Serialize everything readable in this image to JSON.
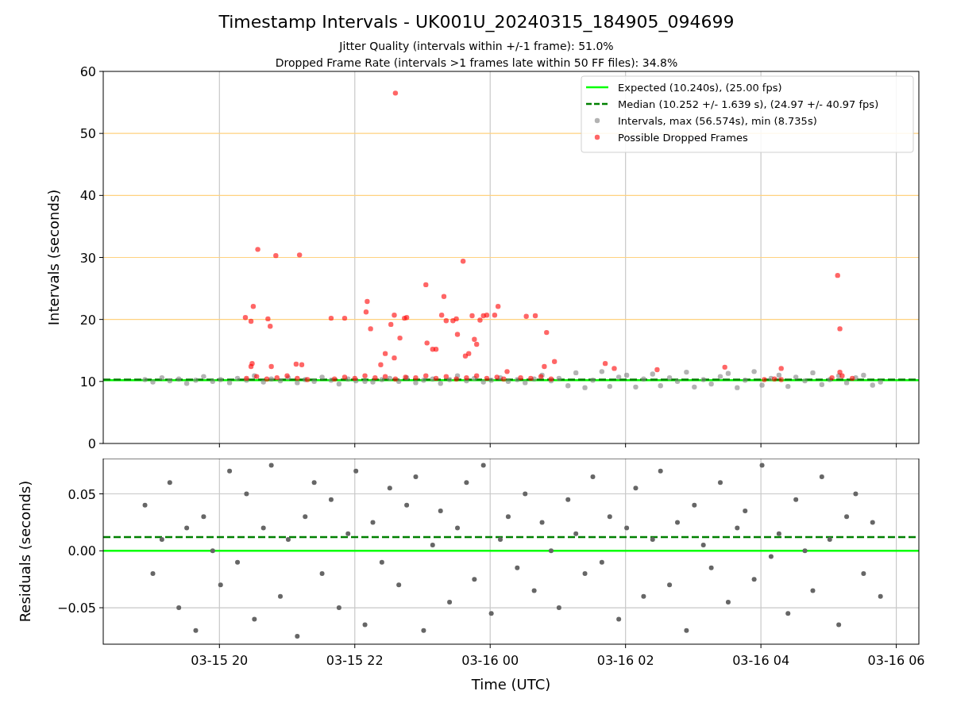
{
  "title": "Timestamp Intervals - UK001U_20240315_184905_094699",
  "subtitles": [
    "Jitter Quality (intervals within +/-1 frame): 51.0%",
    "Dropped Frame Rate (intervals >1 frames late within 50 FF files): 34.8%"
  ],
  "charts": [
    {
      "chart_data": {
        "type": "scatter",
        "grid": true,
        "legend": "upper right",
        "ylabel": "Intervals (seconds)",
        "xlim": [
          "2024-03-15 18:17",
          "2024-03-16 06:20"
        ],
        "ylim": [
          0,
          60
        ],
        "yticks": [
          {
            "value": 0,
            "label": "0"
          },
          {
            "value": 10,
            "label": "10"
          },
          {
            "value": 20,
            "label": "20"
          },
          {
            "value": 30,
            "label": "30"
          },
          {
            "value": 40,
            "label": "40"
          },
          {
            "value": 50,
            "label": "50"
          },
          {
            "value": 60,
            "label": "60"
          }
        ],
        "series": [
          {
            "name": "Expected (10.240s), (25.00 fps)",
            "type": "line",
            "line_style": "solid",
            "color": "#00ff00",
            "x": [
              "2024-03-15 18:17",
              "2024-03-16 06:20"
            ],
            "values": [
              10.2,
              10.2
            ]
          },
          {
            "name": "Median (10.252 +/- 1.639 s), (24.97 +/- 40.97 fps)",
            "type": "line",
            "line_style": "dashed",
            "color": "#008000",
            "x": [
              "2024-03-15 18:17",
              "2024-03-16 06:20"
            ],
            "values": [
              10.3,
              10.3
            ]
          },
          {
            "name": "Intervals, max (56.574s), min (8.735s)",
            "color": "#808080",
            "x": [
              "2024-03-15 18:54",
              "2024-03-15 19:01",
              "2024-03-15 19:09",
              "2024-03-15 19:16",
              "2024-03-15 19:24",
              "2024-03-15 19:31",
              "2024-03-15 19:39",
              "2024-03-15 19:46",
              "2024-03-15 19:54",
              "2024-03-15 20:01",
              "2024-03-15 20:09",
              "2024-03-15 20:16",
              "2024-03-15 20:24",
              "2024-03-15 20:31",
              "2024-03-15 20:39",
              "2024-03-15 20:46",
              "2024-03-15 20:54",
              "2024-03-15 21:01",
              "2024-03-15 21:09",
              "2024-03-15 21:16",
              "2024-03-15 21:24",
              "2024-03-15 21:31",
              "2024-03-15 21:39",
              "2024-03-15 21:46",
              "2024-03-15 21:54",
              "2024-03-15 22:01",
              "2024-03-15 22:09",
              "2024-03-15 22:16",
              "2024-03-15 22:24",
              "2024-03-15 22:31",
              "2024-03-15 22:39",
              "2024-03-15 22:46",
              "2024-03-15 22:54",
              "2024-03-15 23:01",
              "2024-03-15 23:09",
              "2024-03-15 23:16",
              "2024-03-15 23:24",
              "2024-03-15 23:31",
              "2024-03-15 23:39",
              "2024-03-15 23:46",
              "2024-03-15 23:54",
              "2024-03-16 00:01",
              "2024-03-16 00:09",
              "2024-03-16 00:16",
              "2024-03-16 00:24",
              "2024-03-16 00:31",
              "2024-03-16 00:39",
              "2024-03-16 00:46",
              "2024-03-16 00:54",
              "2024-03-16 01:01",
              "2024-03-16 01:09",
              "2024-03-16 01:16",
              "2024-03-16 01:24",
              "2024-03-16 01:31",
              "2024-03-16 01:39",
              "2024-03-16 01:46",
              "2024-03-16 01:54",
              "2024-03-16 02:01",
              "2024-03-16 02:09",
              "2024-03-16 02:16",
              "2024-03-16 02:24",
              "2024-03-16 02:31",
              "2024-03-16 02:39",
              "2024-03-16 02:46",
              "2024-03-16 02:54",
              "2024-03-16 03:01",
              "2024-03-16 03:09",
              "2024-03-16 03:16",
              "2024-03-16 03:24",
              "2024-03-16 03:31",
              "2024-03-16 03:39",
              "2024-03-16 03:46",
              "2024-03-16 03:54",
              "2024-03-16 04:01",
              "2024-03-16 04:09",
              "2024-03-16 04:16",
              "2024-03-16 04:24",
              "2024-03-16 04:31",
              "2024-03-16 04:39",
              "2024-03-16 04:46",
              "2024-03-16 04:54",
              "2024-03-16 05:01",
              "2024-03-16 05:09",
              "2024-03-16 05:16",
              "2024-03-16 05:24",
              "2024-03-16 05:31",
              "2024-03-16 05:39",
              "2024-03-16 05:46"
            ],
            "values": [
              10.3,
              9.9,
              10.6,
              10.1,
              10.4,
              9.7,
              10.2,
              10.8,
              10.0,
              10.3,
              9.8,
              10.5,
              10.2,
              10.9,
              9.9,
              10.4,
              10.1,
              10.6,
              9.8,
              10.3,
              10.0,
              10.7,
              10.2,
              9.6,
              10.4,
              10.1,
              10.0,
              9.9,
              10.3,
              10.5,
              10.0,
              10.6,
              9.8,
              10.2,
              10.4,
              9.7,
              10.3,
              10.9,
              10.1,
              10.5,
              9.9,
              10.2,
              10.6,
              10.0,
              10.3,
              9.8,
              10.4,
              11.0,
              10.1,
              10.5,
              9.3,
              11.4,
              9.0,
              10.2,
              11.6,
              9.2,
              10.7,
              11.0,
              9.1,
              10.4,
              11.2,
              9.3,
              10.6,
              10.0,
              11.5,
              9.1,
              10.3,
              9.6,
              10.8,
              11.3,
              9.0,
              10.2,
              11.6,
              9.4,
              10.5,
              11.0,
              9.2,
              10.7,
              10.1,
              11.4,
              9.5,
              10.3,
              10.9,
              9.8,
              10.6,
              11.0,
              9.4,
              9.9
            ]
          },
          {
            "name": "Possible Dropped Frames",
            "color": "#ff0000",
            "x": [
              "2024-03-15 20:23",
              "2024-03-15 20:28",
              "2024-03-15 20:30",
              "2024-03-15 20:34",
              "2024-03-15 20:28",
              "2024-03-15 20:29",
              "2024-03-15 20:43",
              "2024-03-15 20:45",
              "2024-03-15 20:50",
              "2024-03-15 20:46",
              "2024-03-15 21:08",
              "2024-03-15 21:11",
              "2024-03-15 21:13",
              "2024-03-15 21:39",
              "2024-03-15 21:51",
              "2024-03-15 22:11",
              "2024-03-15 22:10",
              "2024-03-15 22:14",
              "2024-03-15 22:32",
              "2024-03-15 22:36",
              "2024-03-15 22:35",
              "2024-03-15 22:40",
              "2024-03-15 22:44",
              "2024-03-15 22:46",
              "2024-03-15 22:27",
              "2024-03-15 22:23",
              "2024-03-15 22:35",
              "2024-03-15 23:03",
              "2024-03-15 23:04",
              "2024-03-15 23:09",
              "2024-03-15 23:12",
              "2024-03-15 23:17",
              "2024-03-15 23:19",
              "2024-03-15 23:21",
              "2024-03-15 23:27",
              "2024-03-15 23:30",
              "2024-03-15 23:31",
              "2024-03-15 23:36",
              "2024-03-15 23:38",
              "2024-03-15 23:41",
              "2024-03-15 23:44",
              "2024-03-15 23:46",
              "2024-03-15 23:48",
              "2024-03-15 23:51",
              "2024-03-15 23:54",
              "2024-03-15 23:57",
              "2024-03-16 00:04",
              "2024-03-16 00:07",
              "2024-03-16 00:15",
              "2024-03-16 00:32",
              "2024-03-16 00:40",
              "2024-03-16 00:50",
              "2024-03-16 00:48",
              "2024-03-16 00:57",
              "2024-03-16 01:42",
              "2024-03-16 01:50",
              "2024-03-16 02:28",
              "2024-03-16 03:28",
              "2024-03-16 04:18",
              "2024-03-16 05:08",
              "2024-03-16 05:10",
              "2024-03-16 05:10",
              "2024-03-15 20:24",
              "2024-03-15 20:33",
              "2024-03-15 20:42",
              "2024-03-15 20:51",
              "2024-03-15 21:00",
              "2024-03-15 21:09",
              "2024-03-15 21:18",
              "2024-03-15 21:42",
              "2024-03-15 21:51",
              "2024-03-15 22:00",
              "2024-03-15 22:09",
              "2024-03-15 22:18",
              "2024-03-15 22:27",
              "2024-03-15 22:36",
              "2024-03-15 22:45",
              "2024-03-15 22:54",
              "2024-03-15 23:03",
              "2024-03-15 23:12",
              "2024-03-15 23:21",
              "2024-03-15 23:30",
              "2024-03-15 23:39",
              "2024-03-15 23:48",
              "2024-03-15 23:57",
              "2024-03-16 00:06",
              "2024-03-16 00:12",
              "2024-03-16 00:27",
              "2024-03-16 00:36",
              "2024-03-16 00:45",
              "2024-03-16 00:54",
              "2024-03-16 04:03",
              "2024-03-16 04:12",
              "2024-03-16 04:18",
              "2024-03-16 05:03",
              "2024-03-16 05:12",
              "2024-03-16 05:21"
            ],
            "values": [
              20.3,
              19.7,
              22.1,
              31.3,
              12.4,
              12.9,
              20.1,
              18.9,
              30.3,
              12.4,
              12.8,
              30.4,
              12.7,
              20.2,
              20.2,
              22.9,
              21.2,
              18.5,
              19.2,
              56.5,
              20.7,
              17.0,
              20.2,
              20.3,
              14.5,
              12.7,
              13.8,
              25.6,
              16.2,
              15.2,
              15.2,
              20.7,
              23.7,
              19.8,
              19.8,
              20.1,
              17.6,
              29.4,
              14.1,
              14.5,
              20.6,
              16.8,
              16.0,
              19.9,
              20.6,
              20.7,
              20.7,
              22.1,
              11.6,
              20.5,
              20.6,
              17.9,
              12.4,
              13.2,
              12.9,
              12.1,
              11.9,
              12.3,
              12.1,
              27.1,
              18.5,
              11.5,
              10.5,
              10.8,
              10.4,
              10.6,
              10.9,
              10.5,
              10.3,
              10.4,
              10.7,
              10.5,
              10.9,
              10.6,
              10.8,
              10.4,
              10.7,
              10.6,
              10.9,
              10.5,
              10.8,
              10.4,
              10.6,
              10.9,
              10.5,
              10.7,
              10.4,
              10.6,
              10.5,
              10.8,
              10.4,
              10.3,
              10.4,
              10.3,
              10.6,
              10.9,
              10.5
            ]
          }
        ]
      }
    },
    {
      "chart_data": {
        "type": "scatter",
        "grid": true,
        "xlabel": "Time (UTC)",
        "ylabel": "Residuals (seconds)",
        "xlim": [
          "2024-03-15 18:17",
          "2024-03-16 06:20"
        ],
        "ylim": [
          -0.082,
          0.081
        ],
        "xticks": [
          {
            "value": "2024-03-15 20:00",
            "label": "03-15 20"
          },
          {
            "value": "2024-03-15 22:00",
            "label": "03-15 22"
          },
          {
            "value": "2024-03-16 00:00",
            "label": "03-16 00"
          },
          {
            "value": "2024-03-16 02:00",
            "label": "03-16 02"
          },
          {
            "value": "2024-03-16 04:00",
            "label": "03-16 04"
          },
          {
            "value": "2024-03-16 06:00",
            "label": "03-16 06"
          }
        ],
        "yticks": [
          {
            "value": -0.05,
            "label": "−0.05"
          },
          {
            "value": 0,
            "label": "0.00"
          },
          {
            "value": 0.05,
            "label": "0.05"
          }
        ],
        "series": [
          {
            "type": "line",
            "line_style": "solid",
            "color": "#00ff00",
            "x": [
              "2024-03-15 18:17",
              "2024-03-16 06:20"
            ],
            "values": [
              0,
              0
            ]
          },
          {
            "type": "line",
            "line_style": "dashed",
            "color": "#008000",
            "x": [
              "2024-03-15 18:17",
              "2024-03-16 06:20"
            ],
            "values": [
              0.012,
              0.012
            ]
          },
          {
            "color": "#666666",
            "x": [
              "2024-03-15 18:54",
              "2024-03-15 19:01",
              "2024-03-15 19:09",
              "2024-03-15 19:16",
              "2024-03-15 19:24",
              "2024-03-15 19:31",
              "2024-03-15 19:39",
              "2024-03-15 19:46",
              "2024-03-15 19:54",
              "2024-03-15 20:01",
              "2024-03-15 20:09",
              "2024-03-15 20:16",
              "2024-03-15 20:24",
              "2024-03-15 20:31",
              "2024-03-15 20:39",
              "2024-03-15 20:46",
              "2024-03-15 20:54",
              "2024-03-15 21:01",
              "2024-03-15 21:09",
              "2024-03-15 21:16",
              "2024-03-15 21:24",
              "2024-03-15 21:31",
              "2024-03-15 21:39",
              "2024-03-15 21:46",
              "2024-03-15 21:54",
              "2024-03-15 22:01",
              "2024-03-15 22:09",
              "2024-03-15 22:16",
              "2024-03-15 22:24",
              "2024-03-15 22:31",
              "2024-03-15 22:39",
              "2024-03-15 22:46",
              "2024-03-15 22:54",
              "2024-03-15 23:01",
              "2024-03-15 23:09",
              "2024-03-15 23:16",
              "2024-03-15 23:24",
              "2024-03-15 23:31",
              "2024-03-15 23:39",
              "2024-03-15 23:46",
              "2024-03-15 23:54",
              "2024-03-16 00:01",
              "2024-03-16 00:09",
              "2024-03-16 00:16",
              "2024-03-16 00:24",
              "2024-03-16 00:31",
              "2024-03-16 00:39",
              "2024-03-16 00:46",
              "2024-03-16 00:54",
              "2024-03-16 01:01",
              "2024-03-16 01:09",
              "2024-03-16 01:16",
              "2024-03-16 01:24",
              "2024-03-16 01:31",
              "2024-03-16 01:39",
              "2024-03-16 01:46",
              "2024-03-16 01:54",
              "2024-03-16 02:01",
              "2024-03-16 02:09",
              "2024-03-16 02:16",
              "2024-03-16 02:24",
              "2024-03-16 02:31",
              "2024-03-16 02:39",
              "2024-03-16 02:46",
              "2024-03-16 02:54",
              "2024-03-16 03:01",
              "2024-03-16 03:09",
              "2024-03-16 03:16",
              "2024-03-16 03:24",
              "2024-03-16 03:31",
              "2024-03-16 03:39",
              "2024-03-16 03:46",
              "2024-03-16 03:54",
              "2024-03-16 04:01",
              "2024-03-16 04:09",
              "2024-03-16 04:16",
              "2024-03-16 04:24",
              "2024-03-16 04:31",
              "2024-03-16 04:39",
              "2024-03-16 04:46",
              "2024-03-16 04:54",
              "2024-03-16 05:01",
              "2024-03-16 05:09",
              "2024-03-16 05:16",
              "2024-03-16 05:24",
              "2024-03-16 05:31",
              "2024-03-16 05:39",
              "2024-03-16 05:46"
            ],
            "values": [
              0.04,
              -0.02,
              0.01,
              0.06,
              -0.05,
              0.02,
              -0.07,
              0.03,
              0.0,
              -0.03,
              0.07,
              -0.01,
              0.05,
              -0.06,
              0.02,
              0.075,
              -0.04,
              0.01,
              -0.075,
              0.03,
              0.06,
              -0.02,
              0.045,
              -0.05,
              0.015,
              0.07,
              -0.065,
              0.025,
              -0.01,
              0.055,
              -0.03,
              0.04,
              0.065,
              -0.07,
              0.005,
              0.035,
              -0.045,
              0.02,
              0.06,
              -0.025,
              0.075,
              -0.055,
              0.01,
              0.03,
              -0.015,
              0.05,
              -0.035,
              0.025,
              0.0,
              -0.05,
              0.045,
              0.015,
              -0.02,
              0.065,
              -0.01,
              0.03,
              -0.06,
              0.02,
              0.055,
              -0.04,
              0.01,
              0.07,
              -0.03,
              0.025,
              -0.07,
              0.04,
              0.005,
              -0.015,
              0.06,
              -0.045,
              0.02,
              0.035,
              -0.025,
              0.075,
              -0.005,
              0.015,
              -0.055,
              0.045,
              0.0,
              -0.035,
              0.065,
              0.01,
              -0.065,
              0.03,
              0.05,
              -0.02,
              0.025,
              -0.04
            ]
          }
        ]
      }
    }
  ]
}
